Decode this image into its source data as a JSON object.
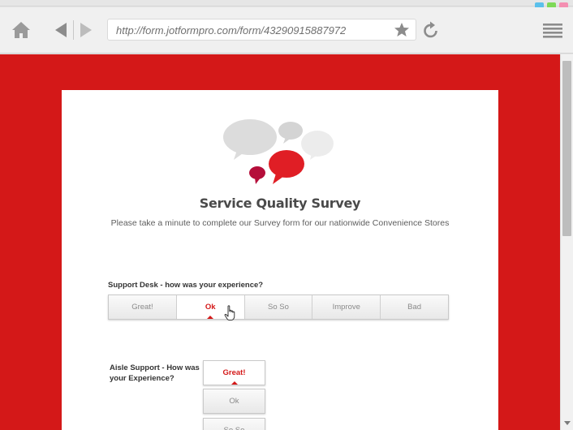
{
  "browser": {
    "url": "http://form.jotformpro.com/form/43290915887972",
    "window_colors": [
      "#5bc0eb",
      "#7ed957",
      "#f48fb1"
    ]
  },
  "form": {
    "title": "Service Quality Survey",
    "subtitle": "Please take a minute to complete our Survey form for our nationwide Convenience Stores",
    "questions": [
      {
        "label": "Support Desk - how was your experience?",
        "options": [
          "Great!",
          "Ok",
          "So So",
          "Improve",
          "Bad"
        ],
        "selected": "Ok"
      },
      {
        "label": "Aisle Support - How was your Experience?",
        "options": [
          "Great!",
          "Ok",
          "So So"
        ],
        "selected": "Great!"
      }
    ]
  },
  "colors": {
    "accent": "#d41818",
    "background": "#d41818"
  }
}
